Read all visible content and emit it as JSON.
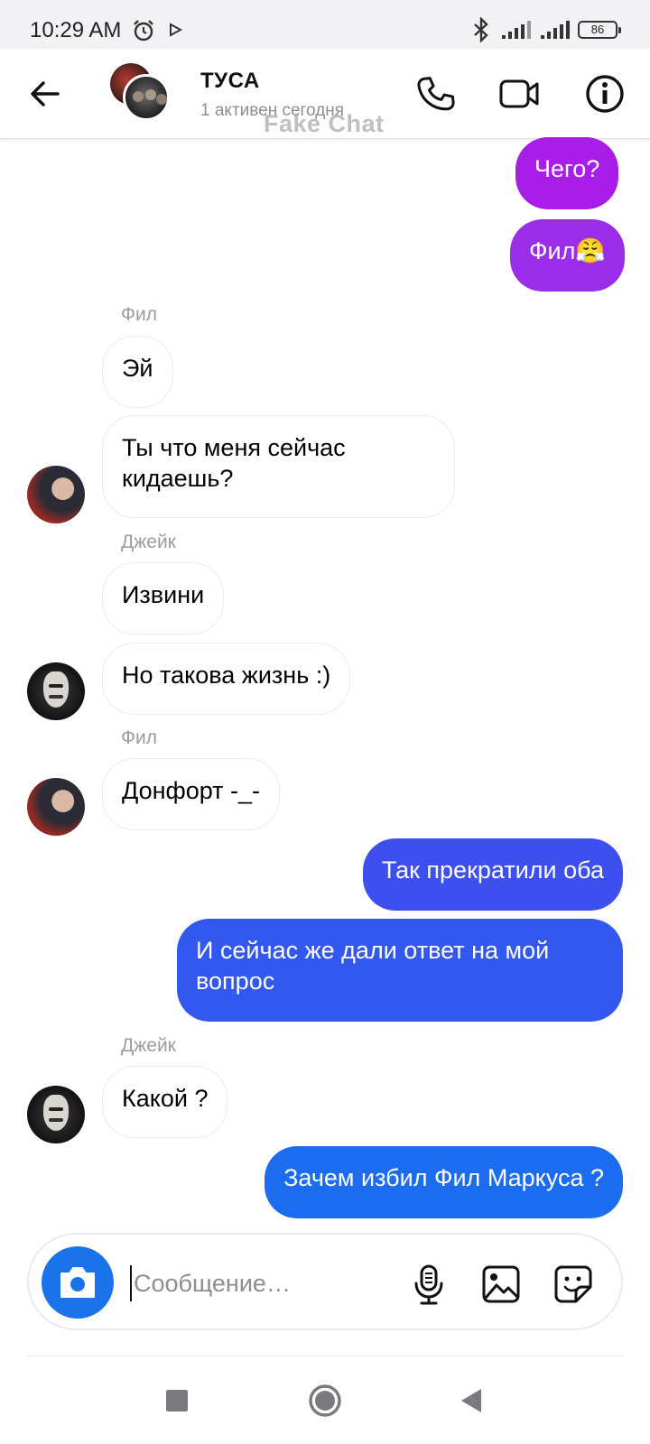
{
  "status_bar": {
    "time": "10:29 AM",
    "battery": "86"
  },
  "header": {
    "title": "ТУСА",
    "subtitle": "1 активен сегодня",
    "watermark": "Fake Chat"
  },
  "messages": [
    {
      "direction": "out",
      "text": "Чего?",
      "color": "#a81de8"
    },
    {
      "direction": "out",
      "text": "Фил😤",
      "color": "#9a2ee8"
    },
    {
      "sender": "Фил"
    },
    {
      "direction": "in",
      "text": "Эй"
    },
    {
      "direction": "in",
      "text": "Ты что меня  сейчас кидаешь?"
    },
    {
      "sender": "Джейк"
    },
    {
      "direction": "in",
      "text": "Извини"
    },
    {
      "direction": "in",
      "text": "Но такова жизнь :)"
    },
    {
      "sender": "Фил"
    },
    {
      "direction": "in",
      "text": "Донфорт -_-"
    },
    {
      "direction": "out",
      "text": "Так прекратили оба",
      "color": "#3e4ff0"
    },
    {
      "direction": "out",
      "text": "И сейчас же дали ответ на мой вопрос",
      "color": "#3358f0"
    },
    {
      "sender": "Джейк"
    },
    {
      "direction": "in",
      "text": "Какой ?"
    },
    {
      "direction": "out",
      "text": "Зачем избил Фил Маркуса ?",
      "color": "#1c6cf0"
    }
  ],
  "composer": {
    "placeholder": "Сообщение…"
  },
  "colors": {
    "accent": "#1a73e8",
    "header_bg": "#ffffff",
    "status_bg": "#f2f2f4"
  },
  "icons": {
    "back": "arrow-left-icon",
    "phone": "phone-icon",
    "video": "video-icon",
    "info": "info-icon",
    "camera": "camera-icon",
    "mic": "microphone-icon",
    "image": "image-icon",
    "sticker": "sticker-icon"
  }
}
